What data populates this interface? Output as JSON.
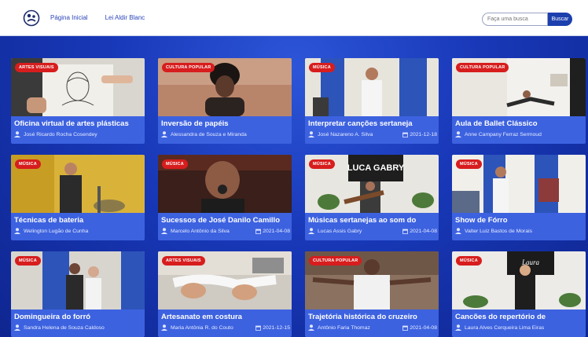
{
  "nav": {
    "links": [
      "Página Inicial",
      "Lei Aldir Blanc"
    ],
    "search_placeholder": "Faça uma busca",
    "search_button": "Buscar"
  },
  "cards": [
    {
      "badge": "ARTES VISUAIS",
      "title": "Oficina virtual de artes plásticas",
      "author": "José Ricardo Rocha Cosendey",
      "date": ""
    },
    {
      "badge": "CULTURA POPULAR",
      "title": "Inversão de papéis",
      "author": "Alessandra de Souza e Miranda",
      "date": ""
    },
    {
      "badge": "MÚSICA",
      "title": "Interpretar canções sertaneja",
      "author": "José Nazareno A. Silva",
      "date": "2021-12-18"
    },
    {
      "badge": "CULTURA POPULAR",
      "title": "Aula de Ballet Clássico",
      "author": "Anne Campany Ferraz Sermoud",
      "date": ""
    },
    {
      "badge": "MÚSICA",
      "title": "Técnicas de bateria",
      "author": "Welington Lugão de Cunha",
      "date": ""
    },
    {
      "badge": "MÚSICA",
      "title": "Sucessos de José Danilo Camillo",
      "author": "Marcelo Antônio da Silva",
      "date": "2021-04-08"
    },
    {
      "badge": "MÚSICA",
      "title": "Músicas sertanejas ao som do",
      "author": "Lucas Assis Gabry",
      "date": "2021-04-08"
    },
    {
      "badge": "MÚSICA",
      "title": "Show de Fórro",
      "author": "Valter Luiz Bastos de Morais",
      "date": ""
    },
    {
      "badge": "MÚSICA",
      "title": "Domingueira do forró",
      "author": "Sandra Helena de Souza Caldoso",
      "date": ""
    },
    {
      "badge": "ARTES VISUAIS",
      "title": "Artesanato em costura",
      "author": "Maria Antônia R. do Couto",
      "date": "2021-12-15"
    },
    {
      "badge": "CULTURA POPULAR",
      "title": "Trajetória histórica do cruzeiro",
      "author": "Antônio Faria Thomaz",
      "date": "2021-04-08"
    },
    {
      "badge": "MÚSICA",
      "title": "Cancões do repertório de",
      "author": "Laura Alves Cerqueira Lima Eiras",
      "date": ""
    }
  ],
  "colors": {
    "badge": "#d71d1d",
    "card": "#3d62e0",
    "accent": "#1c3fae"
  }
}
